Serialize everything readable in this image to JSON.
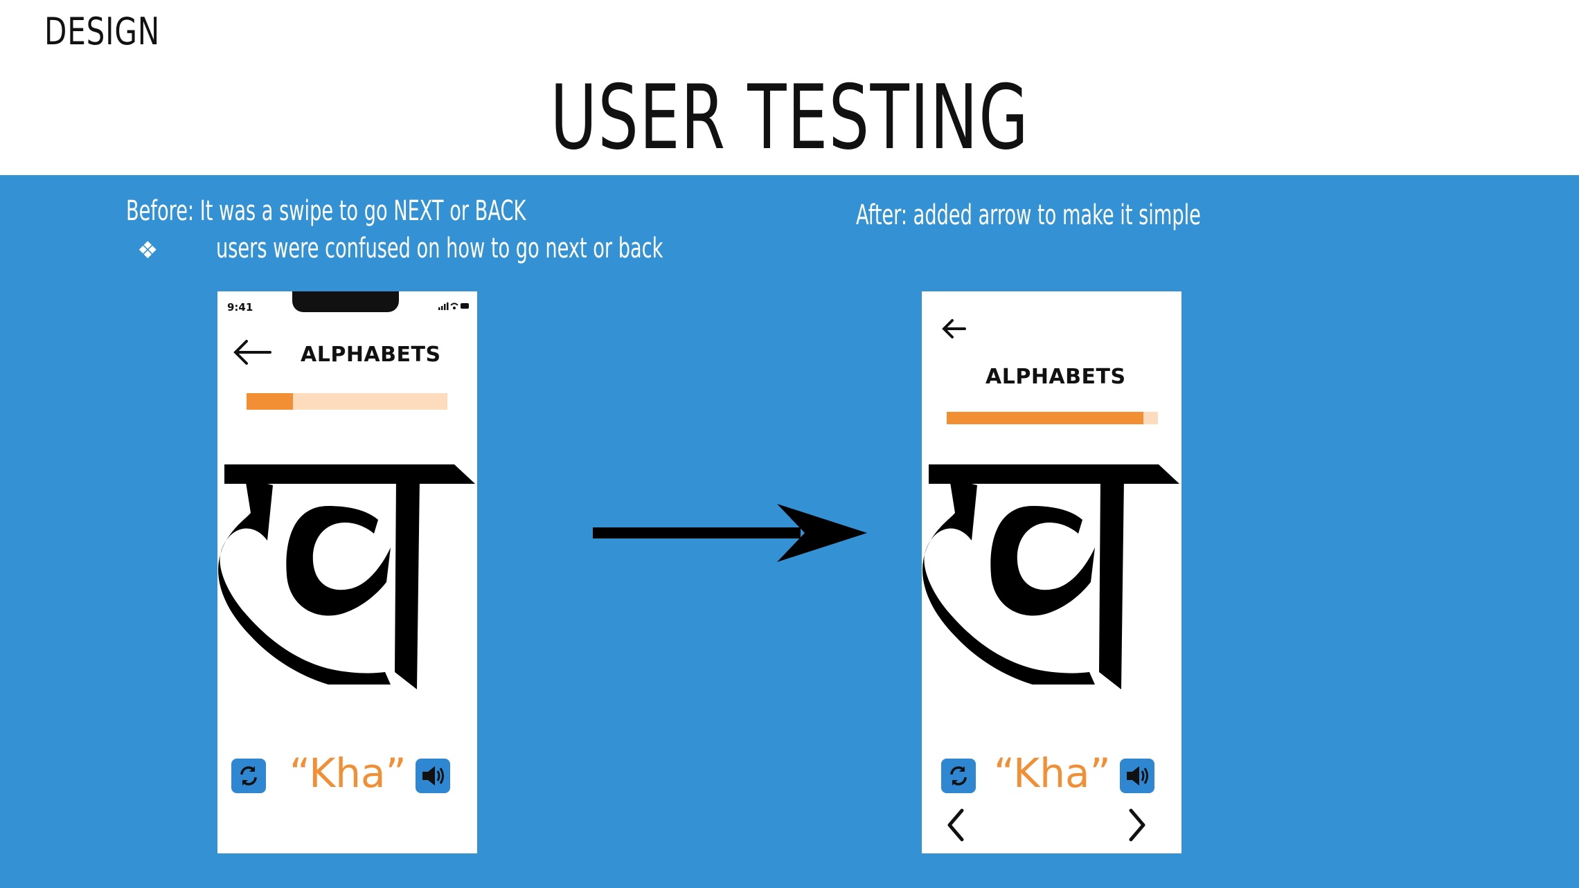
{
  "slide": {
    "section_label": "DESIGN",
    "title": "USER TESTING"
  },
  "before": {
    "heading": "Before: It was a swipe to go NEXT or  BACK",
    "bullet_symbol": "❖",
    "bullet_text": "users were confused on how to go next or back",
    "screen": {
      "status_time": "9:41",
      "title": "ALPHABETS",
      "progress": 0.23,
      "letter": "ख",
      "syllable": "“Kha”",
      "icons": [
        "back-arrow-icon",
        "refresh-icon",
        "speaker-icon"
      ]
    }
  },
  "after": {
    "heading": "After: added arrow to make it simple",
    "screen": {
      "title": "ALPHABETS",
      "progress": 0.93,
      "letter": "ख",
      "syllable": "“Kha”",
      "icons": [
        "back-arrow-icon",
        "refresh-icon",
        "speaker-icon",
        "chevron-left-icon",
        "chevron-right-icon"
      ]
    }
  },
  "transition_icon": "right-arrow-icon",
  "colors": {
    "background_blue": "#3391d4",
    "accent_orange": "#f28e33",
    "progress_track": "#fcdcbd",
    "button_blue": "#2f86d1"
  }
}
